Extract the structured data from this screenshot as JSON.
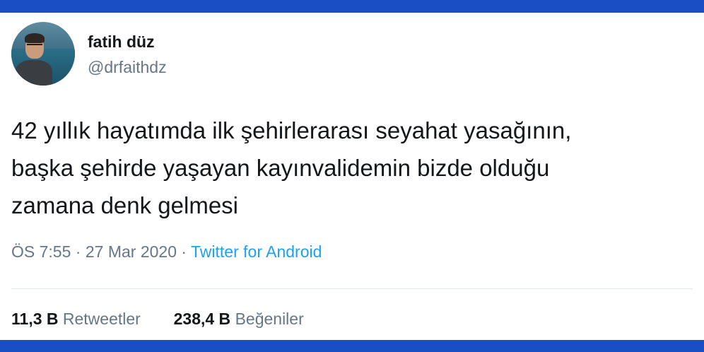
{
  "tweet": {
    "author_name": "fatih düz",
    "author_handle": "@drfaithdz",
    "text_lines": [
      "42 yıllık hayatımda ilk şehirlerarası seyahat yasağının,",
      "başka şehirde yaşayan kayınvalidemin bizde olduğu",
      "zamana denk gelmesi"
    ],
    "time": "ÖS 7:55",
    "date": "27 Mar 2020",
    "separator": "·",
    "source": "Twitter for Android",
    "stats": {
      "retweets_count": "11,3 B",
      "retweets_label": "Retweetler",
      "likes_count": "238,4 B",
      "likes_label": "Beğeniler"
    }
  },
  "colors": {
    "frame": "#1a4fc4",
    "link": "#1da1f2",
    "muted": "#657786",
    "text": "#14171a",
    "divider": "#e1e8ed"
  }
}
